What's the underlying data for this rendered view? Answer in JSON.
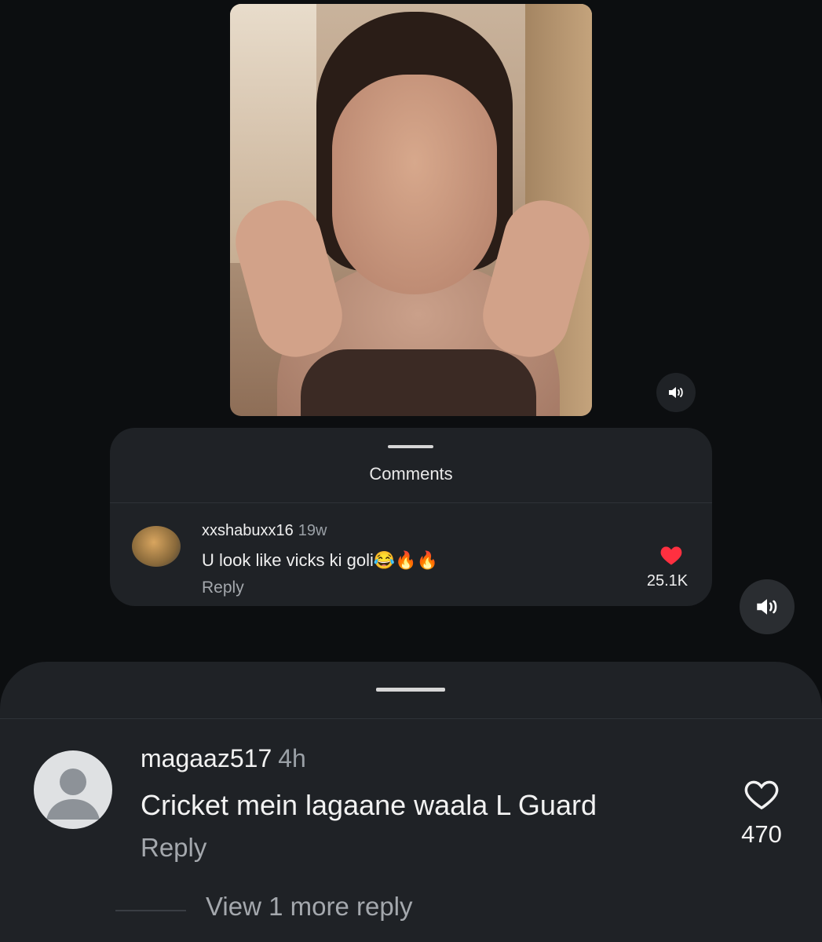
{
  "video": {
    "mute_icon": "speaker-muted-icon"
  },
  "comments_card": {
    "title": "Comments",
    "comment": {
      "username": "xxshabuxx16",
      "time": "19w",
      "text": "U look like vicks ki goli😂🔥🔥",
      "reply_label": "Reply",
      "likes": "25.1K",
      "liked": true,
      "heart_color": "#ff3040"
    }
  },
  "sheet": {
    "comment": {
      "username": "magaaz517",
      "time": "4h",
      "text": "Cricket mein lagaane waala L Guard",
      "reply_label": "Reply",
      "likes": "470",
      "liked": false
    },
    "view_more_label": "View 1 more reply"
  },
  "colors": {
    "background": "#0c0e10",
    "panel": "#1f2226",
    "muted_text": "#a4a8ad"
  }
}
